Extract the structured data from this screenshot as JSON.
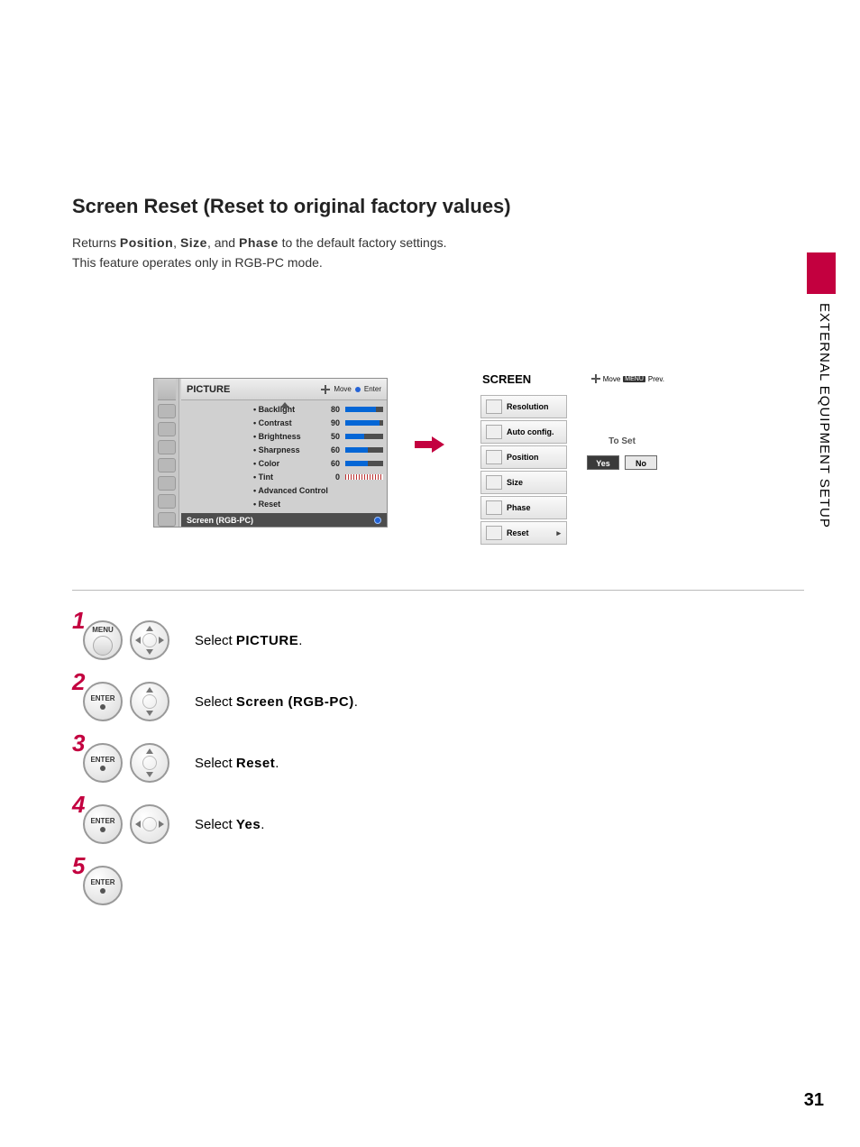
{
  "title": "Screen Reset (Reset to original factory values)",
  "intro": {
    "prefix": "Returns ",
    "kw1": "Position",
    "sep1": ", ",
    "kw2": "Size",
    "sep2": ", and ",
    "kw3": "Phase",
    "suffix": " to the default factory settings.",
    "line2": "This feature operates only in RGB-PC mode."
  },
  "side_tab": "EXTERNAL EQUIPMENT SETUP",
  "page_number": "31",
  "osd_picture": {
    "title": "PICTURE",
    "hint_move": "Move",
    "hint_enter": "Enter",
    "rows": [
      {
        "name": "• Backlight",
        "value": "80",
        "fill": 80
      },
      {
        "name": "• Contrast",
        "value": "90",
        "fill": 90
      },
      {
        "name": "• Brightness",
        "value": "50",
        "fill": 50
      },
      {
        "name": "• Sharpness",
        "value": "60",
        "fill": 60
      },
      {
        "name": "• Color",
        "value": "60",
        "fill": 60
      }
    ],
    "tint": {
      "name": "• Tint",
      "value": "0"
    },
    "adv": "• Advanced Control",
    "reset": "• Reset",
    "footer": "Screen (RGB-PC)"
  },
  "osd_screen": {
    "title": "SCREEN",
    "hint_move": "Move",
    "hint_prev_badge": "MENU",
    "hint_prev": "Prev.",
    "items": [
      "Resolution",
      "Auto config.",
      "Position",
      "Size",
      "Phase",
      "Reset"
    ],
    "to_set": "To Set",
    "yes": "Yes",
    "no": "No"
  },
  "steps": {
    "s1": {
      "num": "1",
      "btn": "MENU",
      "prefix": "Select ",
      "kw": "PICTURE",
      "suffix": "."
    },
    "s2": {
      "num": "2",
      "btn": "ENTER",
      "prefix": "Select ",
      "kw": "Screen (RGB-PC)",
      "suffix": "."
    },
    "s3": {
      "num": "3",
      "btn": "ENTER",
      "prefix": "Select ",
      "kw": "Reset",
      "suffix": "."
    },
    "s4": {
      "num": "4",
      "btn": "ENTER",
      "prefix": "Select ",
      "kw": "Yes",
      "suffix": "."
    },
    "s5": {
      "num": "5",
      "btn": "ENTER"
    }
  }
}
